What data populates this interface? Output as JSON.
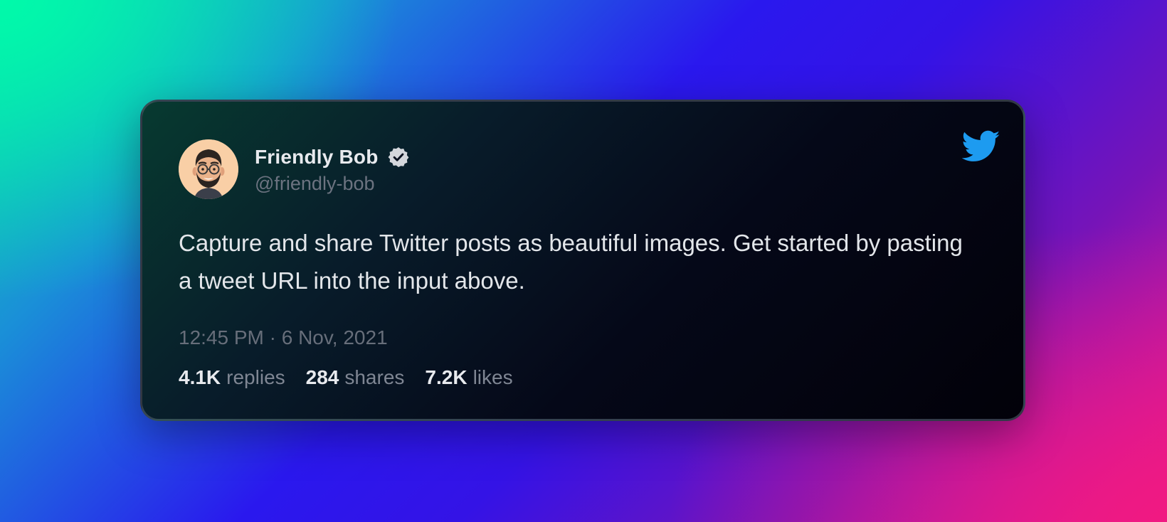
{
  "tweet": {
    "author": {
      "display_name": "Friendly Bob",
      "handle": "@friendly-bob",
      "verified": true,
      "avatar_icon": "memoji-avatar"
    },
    "text": "Capture and share Twitter posts as beautiful images. Get started by pasting a tweet URL into the input above.",
    "timestamp": "12:45 PM · 6 Nov, 2021",
    "stats": {
      "replies": {
        "count": "4.1K",
        "label": "replies"
      },
      "shares": {
        "count": "284",
        "label": "shares"
      },
      "likes": {
        "count": "7.2K",
        "label": "likes"
      }
    },
    "brand_icon": "twitter-bird-icon"
  },
  "colors": {
    "twitter_blue": "#1d9bf0",
    "verified_badge": "#d4d7dc",
    "avatar_background": "#f9cfa6"
  }
}
